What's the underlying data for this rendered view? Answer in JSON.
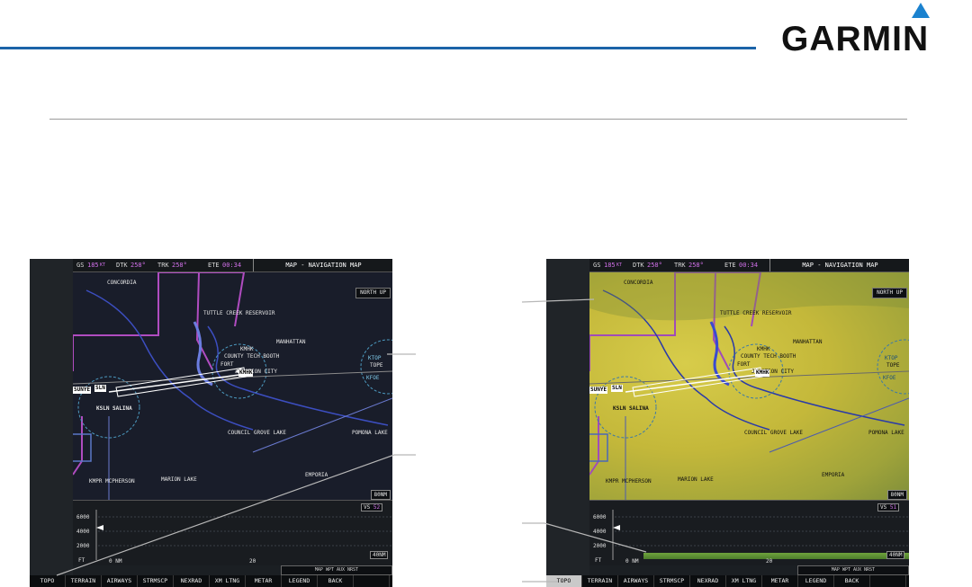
{
  "brand": {
    "name": "GARMIN",
    "accent": "#1b63a8"
  },
  "screens": [
    {
      "id": "left",
      "style": "dark",
      "databar": {
        "gs_label": "GS",
        "gs_value": "185",
        "gs_unit": "KT",
        "dtk_label": "DTK",
        "dtk_value": "258°",
        "trk_label": "TRK",
        "trk_value": "258°",
        "ete_label": "ETE",
        "ete_value": "00:34",
        "page_title": "MAP - NAVIGATION MAP"
      },
      "orientation": "NORTH UP",
      "labels": {
        "concordia": "CONCORDIA",
        "tuttle": "TUTTLE CREEK RESERVOIR",
        "manhattan": "MANHATTAN",
        "kmhk": "KMHK",
        "county": "COUNTY TECH BOOTH",
        "fort": "FORT",
        "junction": "JUNCTION CITY",
        "salina": "KSLN SALINA",
        "council": "COUNCIL GROVE LAKE",
        "pomona": "POMONA LAKE",
        "kfoe": "KFOE",
        "ktop": "KTOP",
        "tope": "TOPE",
        "mcpherson": "KMPR MCPHERSON",
        "marion": "MARION LAKE",
        "emporia": "EMPORIA"
      },
      "route_tags": {
        "sunye": "SUNYE",
        "sln": "SLN",
        "kmhk": "KMHK"
      },
      "map_range": "80NM",
      "profile": {
        "alt_top": "6000",
        "alt_mid": "4000",
        "alt_low": "2000",
        "unit": "FT",
        "vs_label": "VS",
        "vs_value": "52",
        "range": "40NM",
        "dist_zero": "0 NM",
        "dist_mid": "20",
        "status": "MAP WPT AUX NRST"
      },
      "softkeys": [
        "TOPO",
        "TERRAIN",
        "AIRWAYS",
        "STRMSCP",
        "NEXRAD",
        "XM LTNG",
        "METAR",
        "LEGEND",
        "BACK",
        ""
      ],
      "active_softkey": -1
    },
    {
      "id": "right",
      "style": "topo",
      "databar": {
        "gs_label": "GS",
        "gs_value": "185",
        "gs_unit": "KT",
        "dtk_label": "DTK",
        "dtk_value": "258°",
        "trk_label": "TRK",
        "trk_value": "258°",
        "ete_label": "ETE",
        "ete_value": "00:34",
        "page_title": "MAP - NAVIGATION MAP"
      },
      "orientation": "NORTH UP",
      "labels": {
        "concordia": "CONCORDIA",
        "tuttle": "TUTTLE CREEK RESERVOIR",
        "manhattan": "MANHATTAN",
        "kmhk": "KMHK",
        "county": "COUNTY TECH BOOTH",
        "fort": "FORT",
        "junction": "JUNCTION CITY",
        "salina": "KSLN SALINA",
        "council": "COUNCIL GROVE LAKE",
        "pomona": "POMONA LAKE",
        "kfoe": "KFOE",
        "ktop": "KTOP",
        "tope": "TOPE",
        "mcpherson": "KMPR MCPHERSON",
        "marion": "MARION LAKE",
        "emporia": "EMPORIA"
      },
      "route_tags": {
        "sunye": "SUNYE",
        "sln": "SLN",
        "kmhk": "KMHK"
      },
      "map_range": "80NM",
      "profile": {
        "alt_top": "6000",
        "alt_mid": "4000",
        "alt_low": "2000",
        "unit": "FT",
        "vs_label": "VS",
        "vs_value": "51",
        "range": "40NM",
        "dist_zero": "0 NM",
        "dist_mid": "20",
        "status": "MAP WPT AUX NRST"
      },
      "softkeys": [
        "TOPO",
        "TERRAIN",
        "AIRWAYS",
        "STRMSCP",
        "NEXRAD",
        "XM LTNG",
        "METAR",
        "LEGEND",
        "BACK",
        ""
      ],
      "active_softkey": 0
    }
  ]
}
